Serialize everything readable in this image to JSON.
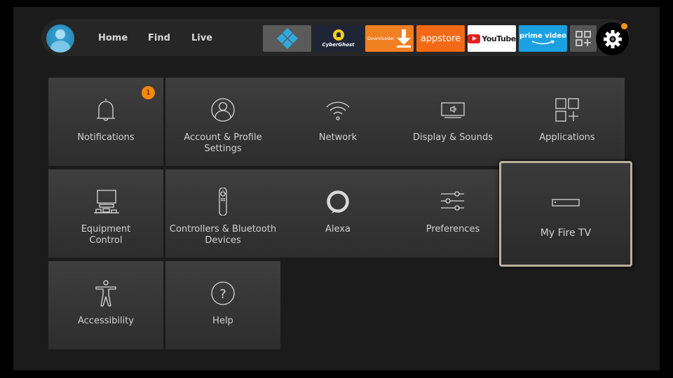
{
  "nav": {
    "links": [
      "Home",
      "Find",
      "Live"
    ],
    "apps": [
      {
        "name": "Kodi",
        "icon": "kodi-icon"
      },
      {
        "name": "CyberGhost",
        "label": "CyberGhost"
      },
      {
        "name": "Downloader",
        "label": "Downloader"
      },
      {
        "name": "appstore",
        "label": "appstore"
      },
      {
        "name": "YouTube",
        "label": "YouTube"
      },
      {
        "name": "prime video",
        "label": "prime video"
      },
      {
        "name": "Apps",
        "icon": "apps-grid-icon"
      }
    ],
    "settings_notification": true
  },
  "tiles": [
    {
      "label": "Notifications",
      "icon": "bell-icon",
      "badge": "1"
    },
    {
      "label": "Account & Profile Settings",
      "icon": "user-circle-icon"
    },
    {
      "label": "Network",
      "icon": "wifi-icon"
    },
    {
      "label": "Display & Sounds",
      "icon": "tv-speaker-icon"
    },
    {
      "label": "Applications",
      "icon": "apps-grid-icon"
    },
    {
      "label": "Equipment Control",
      "icon": "equipment-icon"
    },
    {
      "label": "Controllers & Bluetooth Devices",
      "icon": "remote-icon"
    },
    {
      "label": "Alexa",
      "icon": "alexa-ring-icon"
    },
    {
      "label": "Preferences",
      "icon": "sliders-icon"
    },
    {
      "label": "My Fire TV",
      "icon": "fire-tv-device-icon",
      "focused": true
    },
    {
      "label": "Accessibility",
      "icon": "accessibility-icon"
    },
    {
      "label": "Help",
      "icon": "help-circle-icon"
    }
  ],
  "colors": {
    "badge": "#f5870e",
    "focus_border": "#b9b19f",
    "background": "#1b1b1b"
  }
}
